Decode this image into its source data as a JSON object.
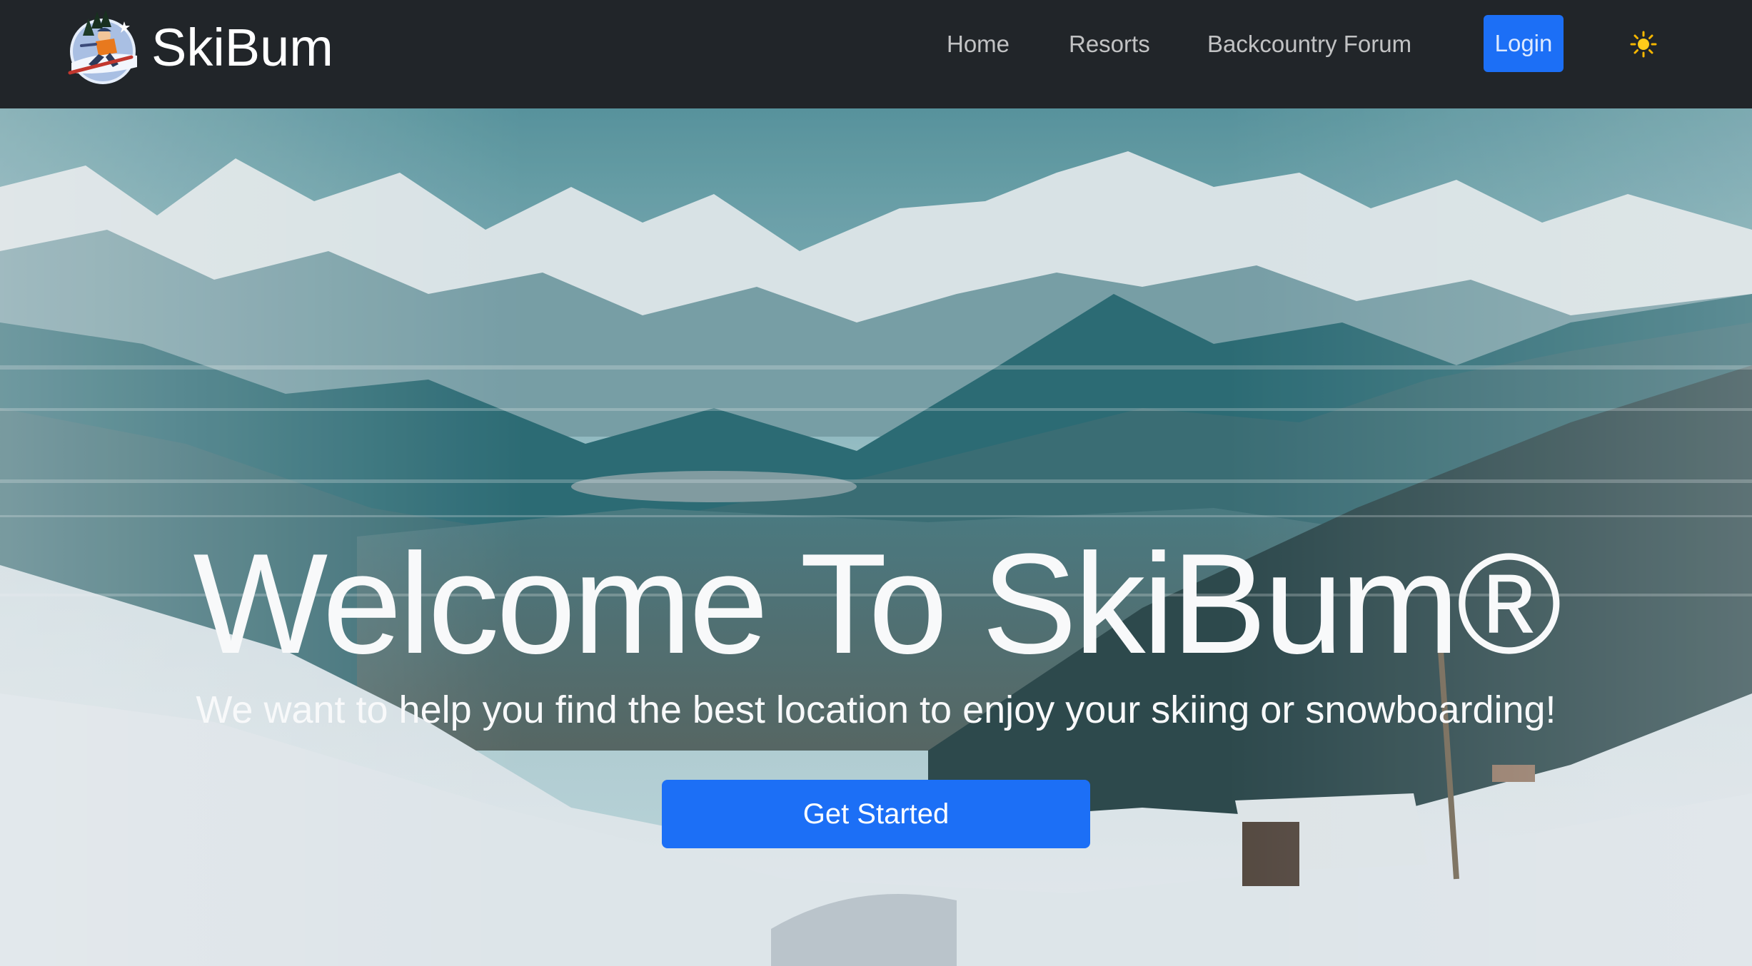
{
  "navbar": {
    "brand_name": "SkiBum",
    "logo_icon": "skier-logo-icon",
    "links": [
      {
        "label": "Home"
      },
      {
        "label": "Resorts"
      },
      {
        "label": "Backcountry Forum"
      }
    ],
    "login_label": "Login",
    "theme_toggle_icon": "sun-icon"
  },
  "hero": {
    "background": "snowy-mountain-ski-resort-photo",
    "title": "Welcome To SkiBum®",
    "subtitle": "We want to help you find the best location to enjoy your skiing or snowboarding!",
    "cta_label": "Get Started"
  },
  "colors": {
    "navbar_bg": "#212529",
    "primary": "#1c6ff6",
    "hero_text": "#f8f9fa"
  }
}
